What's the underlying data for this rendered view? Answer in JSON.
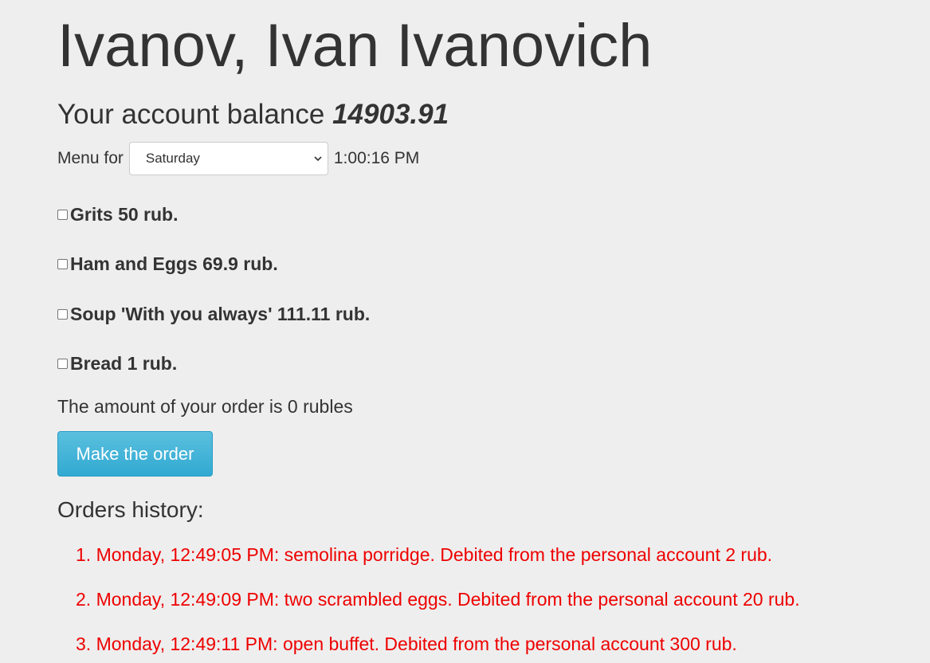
{
  "user": {
    "name": "Ivanov, Ivan Ivanovich"
  },
  "balance": {
    "label": "Your account balance",
    "amount": "14903.91"
  },
  "menu": {
    "label": "Menu for",
    "selected_day": "Saturday",
    "time": "1:00:16 PM"
  },
  "dishes": [
    {
      "label": "Grits 50 rub.",
      "checked": false
    },
    {
      "label": "Ham and Eggs 69.9 rub.",
      "checked": false
    },
    {
      "label": "Soup 'With you always' 111.11 rub.",
      "checked": false
    },
    {
      "label": "Bread 1 rub.",
      "checked": false
    }
  ],
  "order": {
    "total_text": "The amount of your order is 0 rubles",
    "button_label": "Make the order"
  },
  "history": {
    "title": "Orders history:",
    "items": [
      "1. Monday, 12:49:05 PM: semolina porridge. Debited from the personal account 2 rub.",
      "2. Monday, 12:49:09 PM: two scrambled eggs. Debited from the personal account 20 rub.",
      "3. Monday, 12:49:11 PM: open buffet. Debited from the personal account 300 rub."
    ]
  },
  "colors": {
    "background": "#eeeeee",
    "text": "#333333",
    "button": "#31b0d5",
    "history_text": "#ee0000"
  },
  "icons": {
    "select_arrow": "chevron-down-icon",
    "checkbox": "checkbox-icon"
  }
}
